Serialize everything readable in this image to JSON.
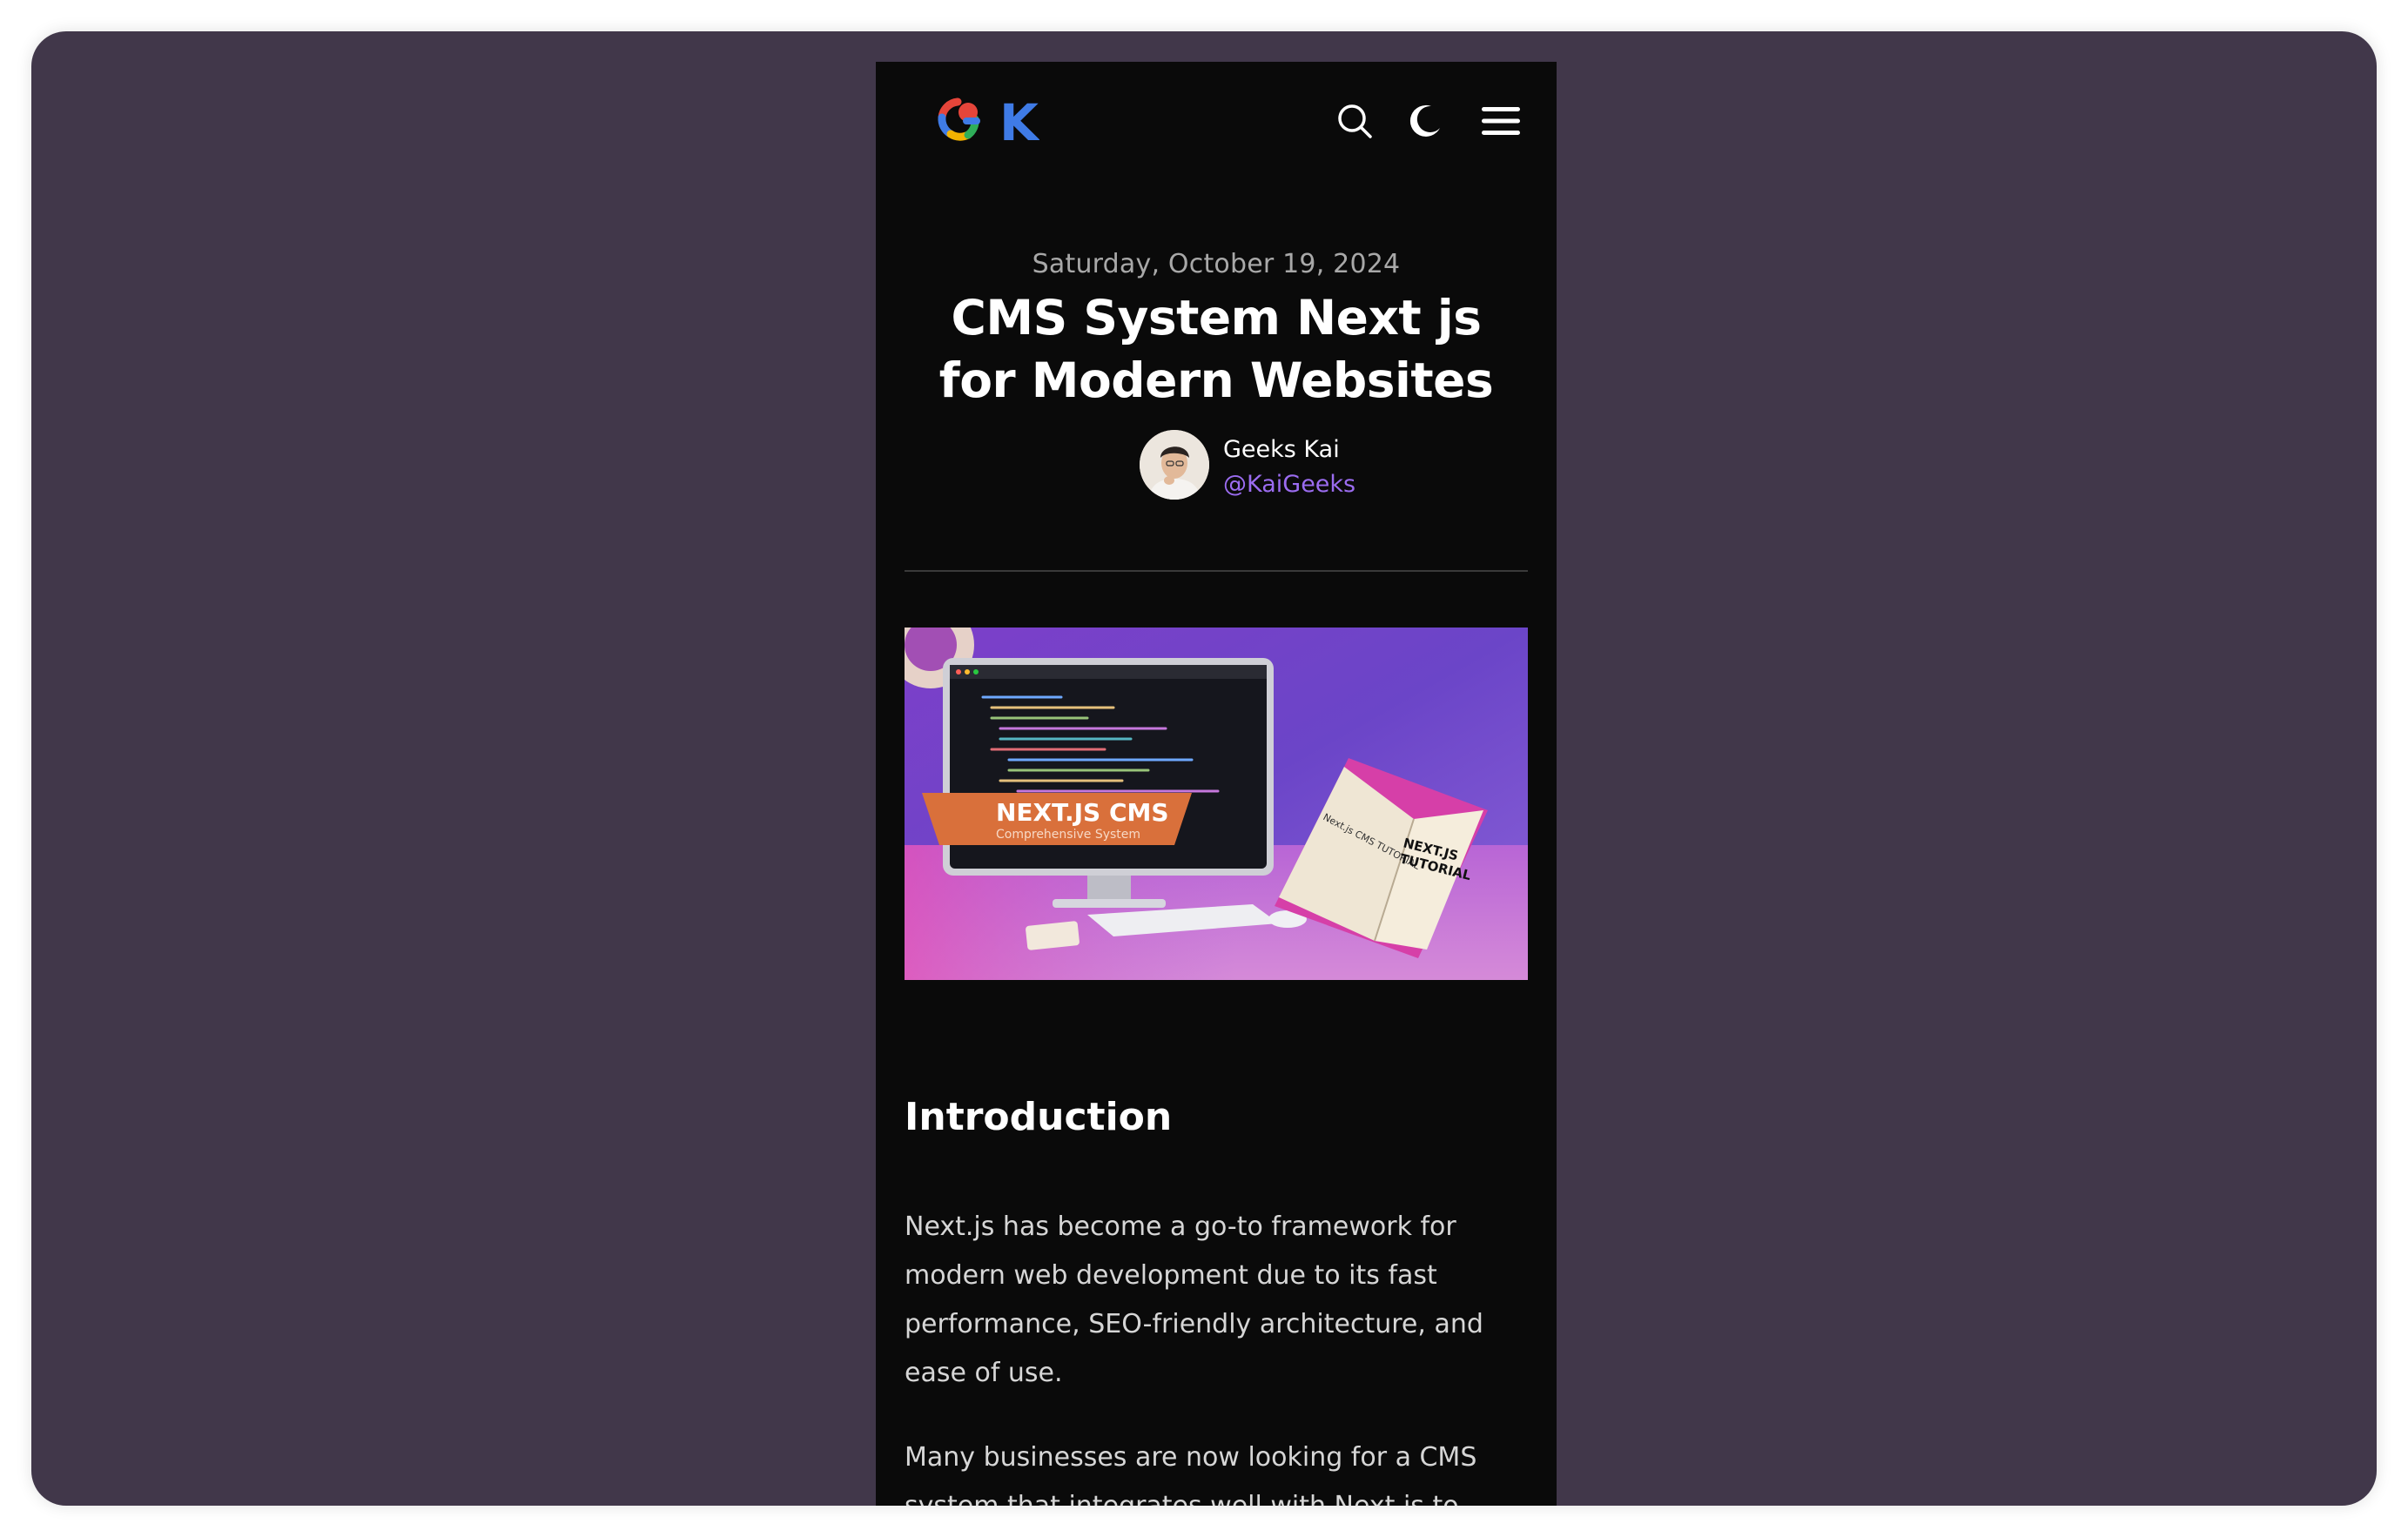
{
  "header": {
    "logo_alt": "GK",
    "logo_letter": "K",
    "icons": [
      "search-icon",
      "moon-icon",
      "menu-icon"
    ]
  },
  "post": {
    "date": "Saturday, October 19, 2024",
    "title": "CMS System Next js for Modern Websites",
    "author": {
      "name": "Geeks Kai",
      "handle": "@KaiGeeks"
    },
    "hero": {
      "banner_title": "NEXT.JS CMS",
      "banner_subtitle": "Comprehensive System",
      "book_left": "Next.js CMS TUTORIAL",
      "book_right_line1": "NEXT.JS",
      "book_right_line2": "TUTORIAL"
    },
    "section_title": "Introduction",
    "paragraphs": [
      "Next.js has become a go-to framework for modern web development due to its fast performance, SEO-friendly architecture, and ease of use.",
      "Many businesses are now looking for a CMS system that integrates well with Next.js to"
    ]
  },
  "colors": {
    "window_bg": "#41374a",
    "page_bg": "#0a0a0a",
    "accent": "#9b6cf0",
    "logo_k": "#3f7be6"
  }
}
